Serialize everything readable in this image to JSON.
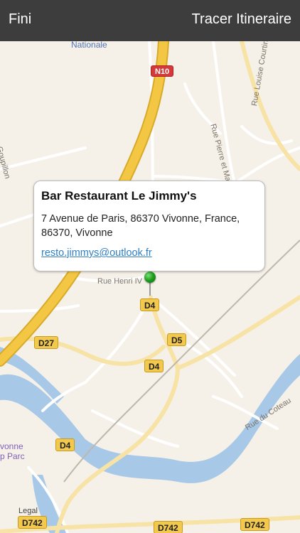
{
  "topbar": {
    "done_label": "Fini",
    "route_label": "Tracer Itineraire"
  },
  "callout": {
    "name": "Bar Restaurant Le Jimmy's",
    "address": "7 Avenue de Paris, 86370 Vivonne, France, 86370, Vivonne",
    "email": "resto.jimmys@outlook.fr"
  },
  "map": {
    "place_labels": {
      "nationale": "Nationale",
      "rue_pierre": "Rue Pierre et Marie Curie",
      "rue_louise": "Rue Louise Courtin",
      "goupillon": "e Goupillon",
      "rue_henri": "Rue Henri IV",
      "rue_coteau": "Rue du Coteau",
      "vivonne": "vonne",
      "parc": "p Parc",
      "legal": "Legal"
    },
    "road_shields": {
      "n10": "N10",
      "d4_a": "D4",
      "d5": "D5",
      "d4_b": "D4",
      "d27": "D27",
      "d4_c": "D4",
      "d742_a": "D742",
      "d742_b": "D742",
      "d742_c": "D742"
    },
    "colors": {
      "highway": "#f3c744",
      "water": "#a7c9e7",
      "land": "#f6f1e8",
      "roads": "#ffffff"
    }
  }
}
